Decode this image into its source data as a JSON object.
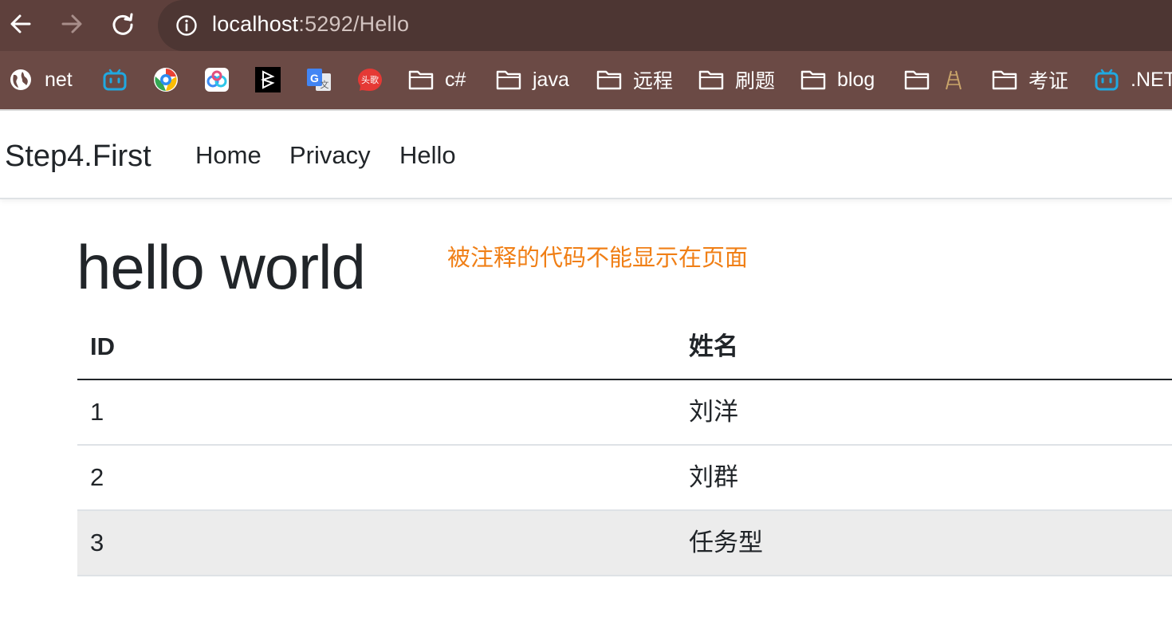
{
  "browser": {
    "url_host": "localhost",
    "url_rest": ":5292/Hello",
    "bookmarks": [
      {
        "label": "net",
        "icon": "globe-icon"
      },
      {
        "label": "",
        "icon": "bilibili-icon"
      },
      {
        "label": "",
        "icon": "chrome-like-icon"
      },
      {
        "label": "",
        "icon": "baidu-netdisk-icon"
      },
      {
        "label": "",
        "icon": "black-square-app-icon"
      },
      {
        "label": "",
        "icon": "google-translate-icon"
      },
      {
        "label": "",
        "icon": "toutiao-icon"
      },
      {
        "label": "c#",
        "icon": "folder-icon"
      },
      {
        "label": "java",
        "icon": "folder-icon"
      },
      {
        "label": "远程",
        "icon": "folder-icon"
      },
      {
        "label": "刷题",
        "icon": "folder-icon"
      },
      {
        "label": "blog",
        "icon": "folder-icon"
      },
      {
        "label": "",
        "icon": "folder-icon"
      },
      {
        "label": "考证",
        "icon": "folder-icon"
      },
      {
        "label": ".NET",
        "icon": "bilibili-icon"
      }
    ],
    "toutiao_text": "头歌",
    "colors": {
      "toolbar": "#5e403c",
      "bookmarks_bar": "#6b4a45",
      "omnibox": "#4d3633"
    }
  },
  "navbar": {
    "brand": "Step4.First",
    "links": [
      "Home",
      "Privacy",
      "Hello"
    ]
  },
  "main": {
    "heading": "hello world",
    "note": "被注释的代码不能显示在页面",
    "note_color": "#f07f16",
    "table": {
      "columns": [
        "ID",
        "姓名"
      ],
      "rows": [
        [
          "1",
          "刘洋"
        ],
        [
          "2",
          "刘群"
        ],
        [
          "3",
          "任务型"
        ]
      ]
    }
  }
}
